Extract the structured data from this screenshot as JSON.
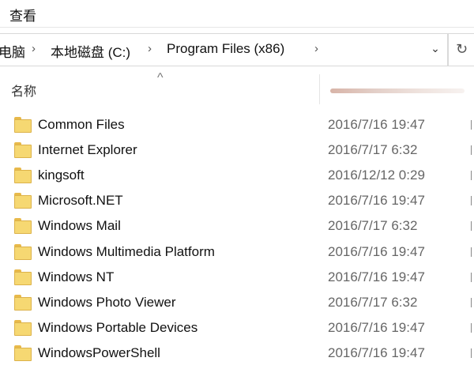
{
  "menu": {
    "view": "查看"
  },
  "address": {
    "crumbs": [
      "电脑",
      "本地磁盘 (C:)",
      "Program Files (x86)"
    ],
    "refresh_icon": "↻"
  },
  "columns": {
    "name": "名称"
  },
  "files": [
    {
      "name": "Common Files",
      "date": "2016/7/16 19:47"
    },
    {
      "name": "Internet Explorer",
      "date": "2016/7/17 6:32"
    },
    {
      "name": "kingsoft",
      "date": "2016/12/12 0:29"
    },
    {
      "name": "Microsoft.NET",
      "date": "2016/7/16 19:47"
    },
    {
      "name": "Windows Mail",
      "date": "2016/7/17 6:32"
    },
    {
      "name": "Windows Multimedia Platform",
      "date": "2016/7/16 19:47"
    },
    {
      "name": "Windows NT",
      "date": "2016/7/16 19:47"
    },
    {
      "name": "Windows Photo Viewer",
      "date": "2016/7/17 6:32"
    },
    {
      "name": "Windows Portable Devices",
      "date": "2016/7/16 19:47"
    },
    {
      "name": "WindowsPowerShell",
      "date": "2016/7/16 19:47"
    }
  ],
  "colors": {
    "folder": "#f6d872",
    "folder_edge": "#dcb24a",
    "date_text": "#666666"
  }
}
